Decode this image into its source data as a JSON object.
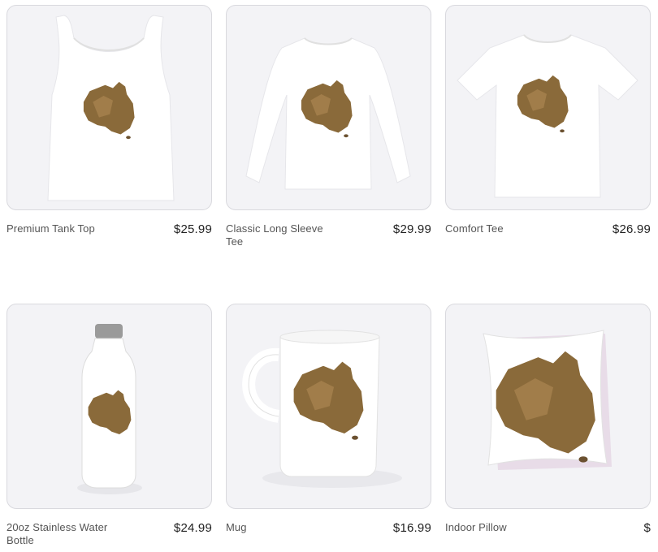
{
  "products": [
    {
      "name": "Premium Tank Top",
      "price": "$25.99",
      "icon": "tank-top"
    },
    {
      "name": "Classic Long Sleeve Tee",
      "price": "$29.99",
      "icon": "long-sleeve-tee"
    },
    {
      "name": "Comfort Tee",
      "price": "$26.99",
      "icon": "t-shirt"
    },
    {
      "name": "20oz Stainless Water Bottle",
      "price": "$24.99",
      "icon": "water-bottle"
    },
    {
      "name": "Mug",
      "price": "$16.99",
      "icon": "mug"
    },
    {
      "name": "Indoor Pillow",
      "price": "$",
      "icon": "pillow"
    }
  ],
  "colors": {
    "card_background": "#f3f3f6",
    "card_border": "#d9d9de",
    "design_brown": "#8a6a3a"
  }
}
